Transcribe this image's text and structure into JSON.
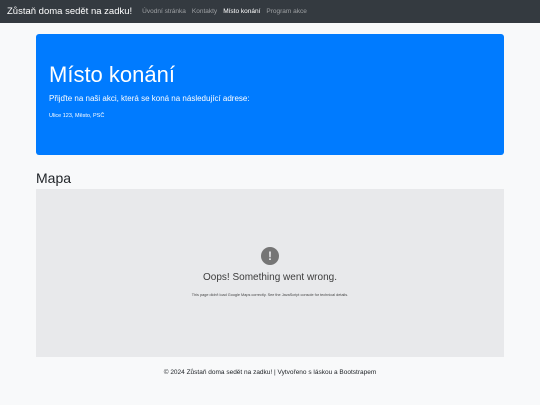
{
  "navbar": {
    "brand": "Zůstaň doma sedět na zadku!",
    "links": [
      {
        "label": "Úvodní stránka",
        "active": false
      },
      {
        "label": "Kontakty",
        "active": false
      },
      {
        "label": "Místo konání",
        "active": true
      },
      {
        "label": "Program akce",
        "active": false
      }
    ]
  },
  "jumbotron": {
    "title": "Místo konání",
    "lead": "Přijďte na naši akci, která se koná na následující adrese:",
    "address": "Ulice 123, Město, PSČ"
  },
  "map": {
    "heading": "Mapa",
    "error_title": "Oops! Something went wrong.",
    "error_detail": "This page didn't load Google Maps correctly. See the JavaScript console for technical details.",
    "error_icon": "exclamation-icon"
  },
  "footer": {
    "text": "© 2024 Zůstaň doma sedět na zadku! | Vytvořeno s láskou a Bootstrapem"
  },
  "colors": {
    "navbar_bg": "#343a40",
    "jumbotron_bg": "#007bff",
    "page_bg": "#f8f9fa",
    "map_bg": "#e8e9eb"
  }
}
